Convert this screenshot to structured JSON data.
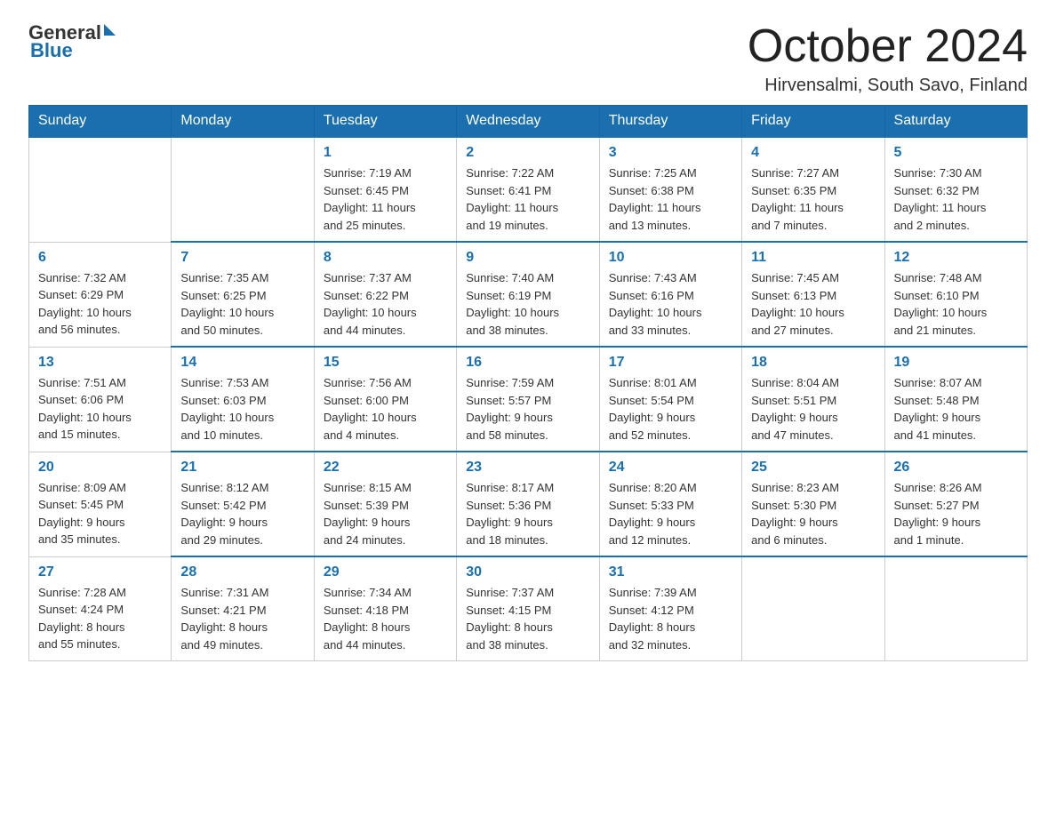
{
  "logo": {
    "text_general": "General",
    "text_blue": "Blue",
    "triangle_note": "blue triangle shape"
  },
  "title": "October 2024",
  "location": "Hirvensalmi, South Savo, Finland",
  "days_of_week": [
    "Sunday",
    "Monday",
    "Tuesday",
    "Wednesday",
    "Thursday",
    "Friday",
    "Saturday"
  ],
  "weeks": [
    [
      {
        "day": "",
        "info": ""
      },
      {
        "day": "",
        "info": ""
      },
      {
        "day": "1",
        "info": "Sunrise: 7:19 AM\nSunset: 6:45 PM\nDaylight: 11 hours\nand 25 minutes."
      },
      {
        "day": "2",
        "info": "Sunrise: 7:22 AM\nSunset: 6:41 PM\nDaylight: 11 hours\nand 19 minutes."
      },
      {
        "day": "3",
        "info": "Sunrise: 7:25 AM\nSunset: 6:38 PM\nDaylight: 11 hours\nand 13 minutes."
      },
      {
        "day": "4",
        "info": "Sunrise: 7:27 AM\nSunset: 6:35 PM\nDaylight: 11 hours\nand 7 minutes."
      },
      {
        "day": "5",
        "info": "Sunrise: 7:30 AM\nSunset: 6:32 PM\nDaylight: 11 hours\nand 2 minutes."
      }
    ],
    [
      {
        "day": "6",
        "info": "Sunrise: 7:32 AM\nSunset: 6:29 PM\nDaylight: 10 hours\nand 56 minutes."
      },
      {
        "day": "7",
        "info": "Sunrise: 7:35 AM\nSunset: 6:25 PM\nDaylight: 10 hours\nand 50 minutes."
      },
      {
        "day": "8",
        "info": "Sunrise: 7:37 AM\nSunset: 6:22 PM\nDaylight: 10 hours\nand 44 minutes."
      },
      {
        "day": "9",
        "info": "Sunrise: 7:40 AM\nSunset: 6:19 PM\nDaylight: 10 hours\nand 38 minutes."
      },
      {
        "day": "10",
        "info": "Sunrise: 7:43 AM\nSunset: 6:16 PM\nDaylight: 10 hours\nand 33 minutes."
      },
      {
        "day": "11",
        "info": "Sunrise: 7:45 AM\nSunset: 6:13 PM\nDaylight: 10 hours\nand 27 minutes."
      },
      {
        "day": "12",
        "info": "Sunrise: 7:48 AM\nSunset: 6:10 PM\nDaylight: 10 hours\nand 21 minutes."
      }
    ],
    [
      {
        "day": "13",
        "info": "Sunrise: 7:51 AM\nSunset: 6:06 PM\nDaylight: 10 hours\nand 15 minutes."
      },
      {
        "day": "14",
        "info": "Sunrise: 7:53 AM\nSunset: 6:03 PM\nDaylight: 10 hours\nand 10 minutes."
      },
      {
        "day": "15",
        "info": "Sunrise: 7:56 AM\nSunset: 6:00 PM\nDaylight: 10 hours\nand 4 minutes."
      },
      {
        "day": "16",
        "info": "Sunrise: 7:59 AM\nSunset: 5:57 PM\nDaylight: 9 hours\nand 58 minutes."
      },
      {
        "day": "17",
        "info": "Sunrise: 8:01 AM\nSunset: 5:54 PM\nDaylight: 9 hours\nand 52 minutes."
      },
      {
        "day": "18",
        "info": "Sunrise: 8:04 AM\nSunset: 5:51 PM\nDaylight: 9 hours\nand 47 minutes."
      },
      {
        "day": "19",
        "info": "Sunrise: 8:07 AM\nSunset: 5:48 PM\nDaylight: 9 hours\nand 41 minutes."
      }
    ],
    [
      {
        "day": "20",
        "info": "Sunrise: 8:09 AM\nSunset: 5:45 PM\nDaylight: 9 hours\nand 35 minutes."
      },
      {
        "day": "21",
        "info": "Sunrise: 8:12 AM\nSunset: 5:42 PM\nDaylight: 9 hours\nand 29 minutes."
      },
      {
        "day": "22",
        "info": "Sunrise: 8:15 AM\nSunset: 5:39 PM\nDaylight: 9 hours\nand 24 minutes."
      },
      {
        "day": "23",
        "info": "Sunrise: 8:17 AM\nSunset: 5:36 PM\nDaylight: 9 hours\nand 18 minutes."
      },
      {
        "day": "24",
        "info": "Sunrise: 8:20 AM\nSunset: 5:33 PM\nDaylight: 9 hours\nand 12 minutes."
      },
      {
        "day": "25",
        "info": "Sunrise: 8:23 AM\nSunset: 5:30 PM\nDaylight: 9 hours\nand 6 minutes."
      },
      {
        "day": "26",
        "info": "Sunrise: 8:26 AM\nSunset: 5:27 PM\nDaylight: 9 hours\nand 1 minute."
      }
    ],
    [
      {
        "day": "27",
        "info": "Sunrise: 7:28 AM\nSunset: 4:24 PM\nDaylight: 8 hours\nand 55 minutes."
      },
      {
        "day": "28",
        "info": "Sunrise: 7:31 AM\nSunset: 4:21 PM\nDaylight: 8 hours\nand 49 minutes."
      },
      {
        "day": "29",
        "info": "Sunrise: 7:34 AM\nSunset: 4:18 PM\nDaylight: 8 hours\nand 44 minutes."
      },
      {
        "day": "30",
        "info": "Sunrise: 7:37 AM\nSunset: 4:15 PM\nDaylight: 8 hours\nand 38 minutes."
      },
      {
        "day": "31",
        "info": "Sunrise: 7:39 AM\nSunset: 4:12 PM\nDaylight: 8 hours\nand 32 minutes."
      },
      {
        "day": "",
        "info": ""
      },
      {
        "day": "",
        "info": ""
      }
    ]
  ]
}
